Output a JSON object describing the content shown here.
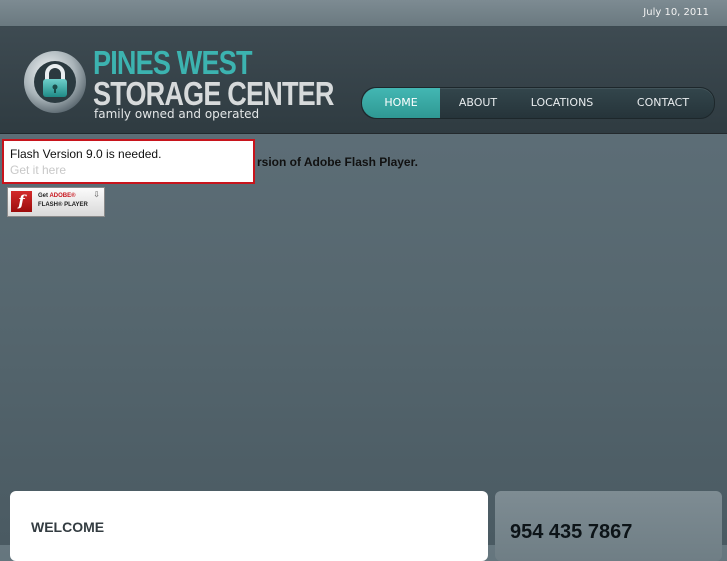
{
  "topbar": {
    "date": "July 10, 2011"
  },
  "header": {
    "logo_icon": "padlock-icon",
    "brand_line1": "PINES WEST",
    "brand_line2": "STORAGE CENTER",
    "tagline": "family owned and operated"
  },
  "nav": {
    "items": [
      {
        "label": "HOME",
        "active": true
      },
      {
        "label": "ABOUT",
        "active": false
      },
      {
        "label": "LOCATIONS",
        "active": false
      },
      {
        "label": "CONTACT",
        "active": false
      }
    ]
  },
  "flash_notice": {
    "message": "Flash Version 9.0 is needed.",
    "link": "Get it here",
    "background_text": "rsion of Adobe Flash Player.",
    "badge": {
      "get": "Get",
      "adobe": "ADOBE®",
      "player": "FLASH® PLAYER",
      "icon": "adobe-flash-icon"
    }
  },
  "welcome": {
    "title": "WELCOME"
  },
  "contact": {
    "phone": "954 435 7867"
  },
  "colors": {
    "accent": "#3cb3b0",
    "alert_border": "#c8141c"
  }
}
